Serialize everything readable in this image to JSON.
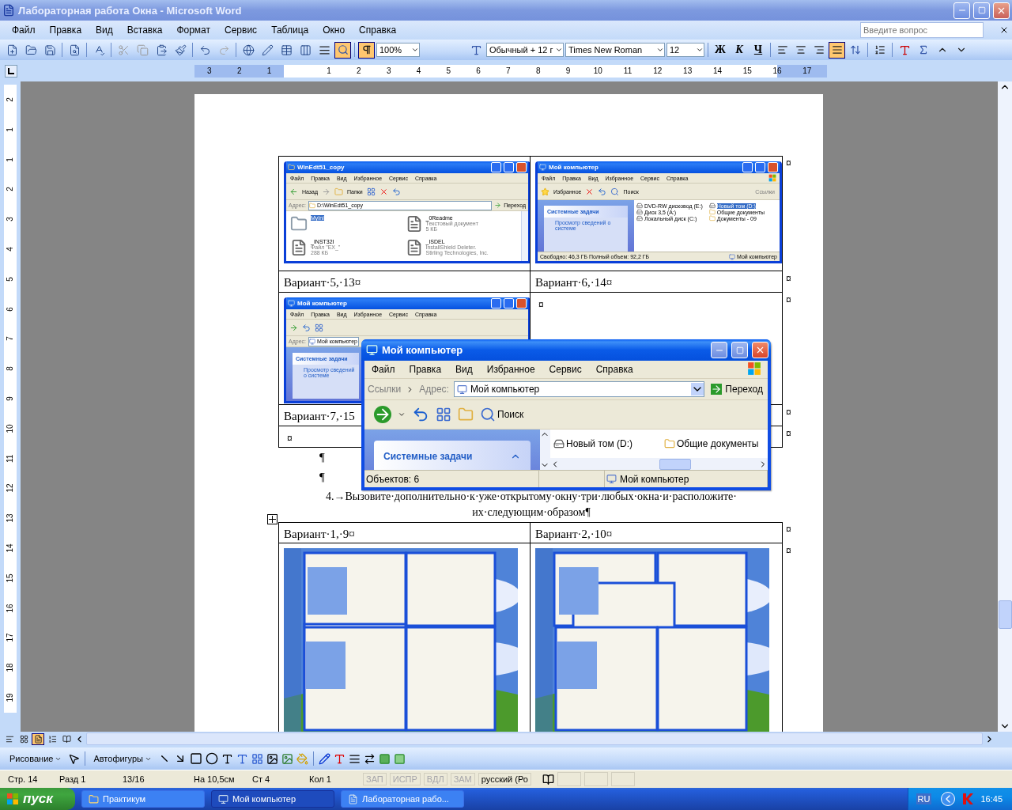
{
  "window": {
    "title": "Лабораторная работа Окна - Microsoft Word"
  },
  "menu": [
    "Файл",
    "Правка",
    "Вид",
    "Вставка",
    "Формат",
    "Сервис",
    "Таблица",
    "Окно",
    "Справка"
  ],
  "help_search": {
    "placeholder": "Введите вопрос"
  },
  "standard_toolbar": {
    "research_on": true,
    "pilcrow_on": true,
    "zoom": "100%"
  },
  "format_toolbar": {
    "style": "Обычный + 12 г",
    "font": "Times New Roman",
    "size": "12",
    "bold": "Ж",
    "italic": "К",
    "underline": "Ч",
    "align": [
      {
        "selected": false
      },
      {
        "selected": false
      },
      {
        "selected": false
      },
      {
        "selected": true
      }
    ]
  },
  "ruler": {
    "left_labels": [
      "3",
      "2",
      "1"
    ],
    "labels": [
      "1",
      "2",
      "3",
      "4",
      "5",
      "6",
      "7",
      "8",
      "9",
      "10",
      "11",
      "12",
      "13",
      "14",
      "15",
      "16",
      "17"
    ]
  },
  "vertical_ruler": {
    "top_labels": [
      "2",
      "1"
    ],
    "labels": [
      "1",
      "2",
      "3",
      "4",
      "5",
      "6",
      "7",
      "8",
      "9",
      "10",
      "11",
      "12",
      "13",
      "14",
      "15",
      "16",
      "17",
      "18",
      "19"
    ]
  },
  "table1": {
    "variant_a": {
      "title": "WinEdt51_copy",
      "menu": [
        "Файл",
        "Правка",
        "Вид",
        "Избранное",
        "Сервис",
        "Справка"
      ],
      "back": "Назад",
      "folders": "Папки",
      "address_label": "Адрес:",
      "address": "D:\\WinEdt51_copy",
      "go": "Переход",
      "files": [
        {
          "name": "MyIni",
          "selected": true
        },
        {
          "name": "_0Readme",
          "selected": false,
          "lines": [
            "Текстовый документ",
            "5 КБ"
          ]
        },
        {
          "name": "_INST32I",
          "selected": false,
          "lines": [
            "Файл \"EX_\"",
            "288 КБ"
          ]
        },
        {
          "name": "_ISDEL",
          "selected": false,
          "lines": [
            "InstallShield Deleter.",
            "Stirling Technologies, Inc."
          ]
        }
      ]
    },
    "variant_b": {
      "title": "Мой компьютер",
      "menu": [
        "Файл",
        "Правка",
        "Вид",
        "Избранное",
        "Сервис",
        "Справка"
      ],
      "favorites": "Избранное",
      "search": "Поиск",
      "links": "Ссылки",
      "tasks_title": "Системные задачи",
      "task_link": "Просмотр сведений о системе",
      "drives": [
        "DVD-RW дисковод (E:)",
        "Диск 3,5 (A:)",
        "Локальный диск (C:)"
      ],
      "folders": [
        {
          "name": "Новый том (D:)",
          "selected": true
        },
        {
          "name": "Общие документы",
          "selected": false
        },
        {
          "name": "Документы - 09",
          "selected": false
        }
      ],
      "status": [
        "Свободно: 46,3 ГБ Полный объем: 92,2 ГБ",
        "Мой компьютер"
      ]
    },
    "caption_a": "Вариант·5,·13¤",
    "caption_b": "Вариант·6,·14¤",
    "variant_c": {
      "title": "Мой компьютер",
      "menu": [
        "Файл",
        "Правка",
        "Вид",
        "Избранное",
        "Сервис",
        "Справка"
      ],
      "address_label": "Адрес:",
      "address": "Мой компьютер",
      "tasks_title": "Системные задачи",
      "task_link": "Просмотр сведений о системе"
    },
    "cell_mark": "¤",
    "caption_c": "Вариант·7,·15",
    "empty_cell_mark": "¤",
    "row_marks": [
      "¤",
      "¤",
      "¤",
      "¤",
      "¤"
    ]
  },
  "paragraph_marks": [
    "¶",
    "¶"
  ],
  "instruction": [
    "4.→Вызовите·дополнительно·к·уже·открытому·окну·три·любых·окна·и·расположите·",
    "их·следующим·образом¶"
  ],
  "table2": {
    "caption_a": "Вариант·1,·9¤",
    "caption_b": "Вариант·2,·10¤",
    "row_marks": [
      "¤",
      "¤"
    ],
    "pictures": [
      {
        "kind": "picture"
      },
      {
        "kind": "picture"
      }
    ]
  },
  "explorer": {
    "title": "Мой компьютер",
    "menu": [
      "Файл",
      "Правка",
      "Вид",
      "Избранное",
      "Сервис",
      "Справка"
    ],
    "links": "Ссылки",
    "address_label": "Адрес:",
    "address": "Мой компьютер",
    "go": "Переход",
    "search": "Поиск",
    "tasks_title": "Системные задачи",
    "items": [
      "Новый том (D:)",
      "Общие документы"
    ],
    "status": [
      "Объектов: 6",
      "Мой компьютер"
    ]
  },
  "view_buttons": [
    {
      "selected": false
    },
    {
      "selected": false
    },
    {
      "selected": true
    },
    {
      "selected": false
    },
    {
      "selected": false
    }
  ],
  "drawing_toolbar": {
    "draw_menu": "Рисование",
    "autoshapes": "Автофигуры"
  },
  "status_bar": {
    "fields": [
      "Стр. 14",
      "Разд 1",
      "13/16",
      "На 10,5см",
      "Ст 4",
      "Кол 1"
    ],
    "modes": [
      {
        "label": "ЗАП",
        "on": false
      },
      {
        "label": "ИСПР",
        "on": false
      },
      {
        "label": "ВДЛ",
        "on": false
      },
      {
        "label": "ЗАМ",
        "on": false
      }
    ],
    "language": "русский (Ро"
  },
  "taskbar": {
    "start": "пуск",
    "tasks": [
      {
        "label": "Практикум",
        "selected": false
      },
      {
        "label": "Мой компьютер",
        "selected": true
      },
      {
        "label": "Лабораторная рабо...",
        "selected": false
      }
    ],
    "lang": "RU",
    "clock": "16:45"
  }
}
